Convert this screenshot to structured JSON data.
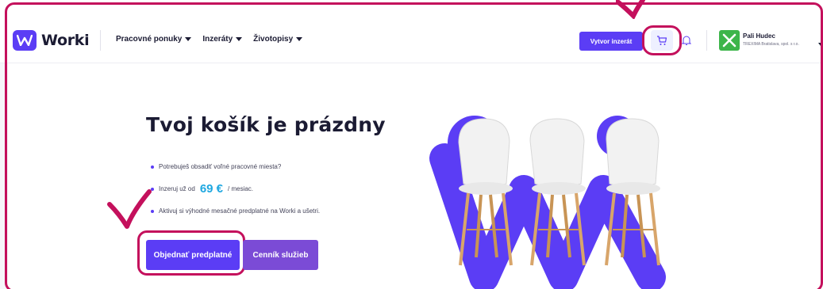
{
  "header": {
    "logo_text": "Worki",
    "nav": [
      {
        "label": "Pracovné ponuky"
      },
      {
        "label": "Inzeráty"
      },
      {
        "label": "Životopisy"
      }
    ],
    "cta_label": "Vytvor inzerát",
    "user": {
      "name": "Pali Hudec",
      "company": "TREXIMA Bratislava, spol. s r.o."
    }
  },
  "main": {
    "title": "Tvoj košík je prázdny",
    "bullets": {
      "b1": "Potrebuješ obsadiť voľné pracovné miesta?",
      "b2_prefix": "Inzeruj už od",
      "b2_price": "69 €",
      "b2_suffix": "/ mesiac.",
      "b3": "Aktivuj si výhodné mesačné predplatné na Worki a ušetri."
    },
    "order_button": "Objednať predplatné",
    "pricing_button": "Cenník služieb"
  },
  "colors": {
    "brand": "#5b3df5",
    "accent_secondary": "#7b4bd6",
    "price": "#1ea7e0",
    "annotation": "#c4105c"
  },
  "icons": {
    "cart": "cart-icon",
    "bell": "bell-icon",
    "logo": "worki-logo-icon"
  }
}
